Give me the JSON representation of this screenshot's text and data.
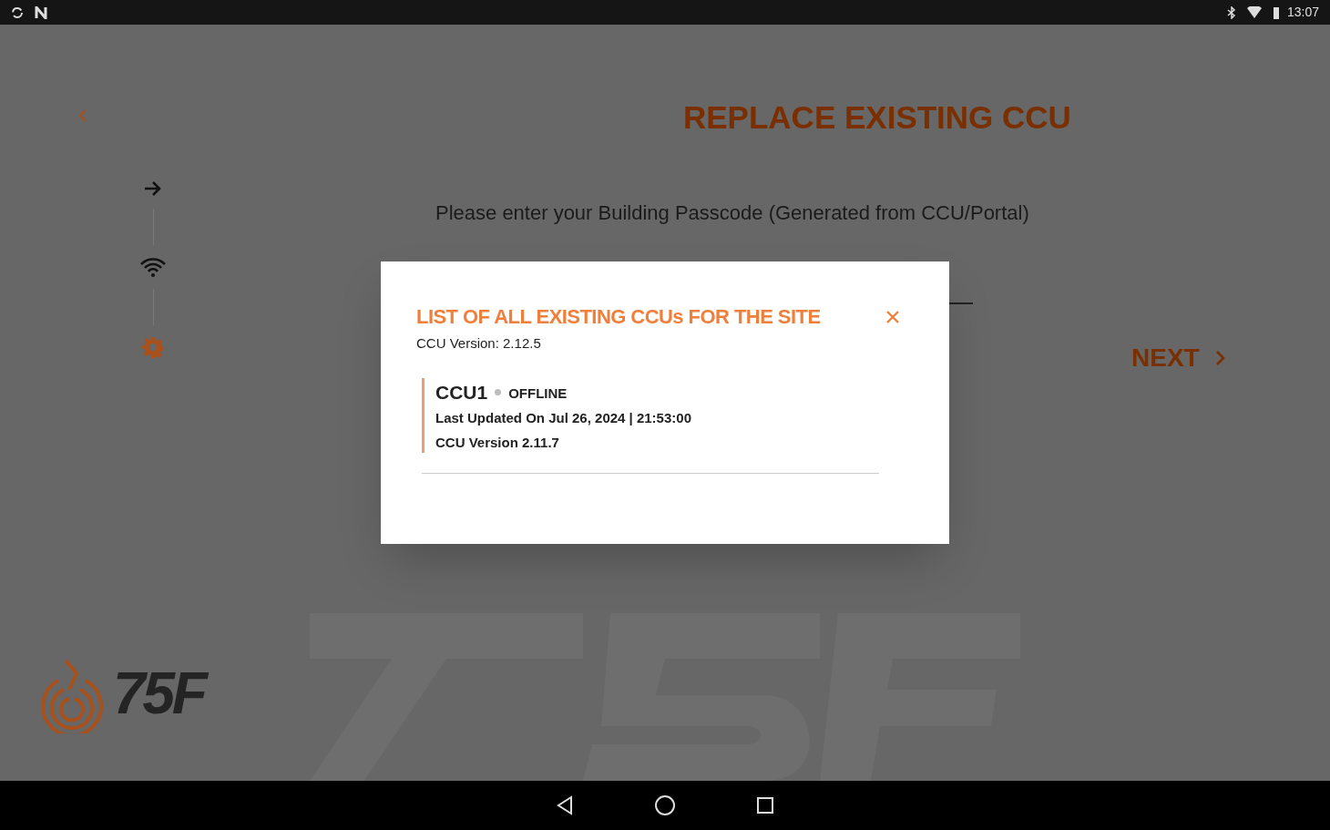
{
  "status_bar": {
    "time": "13:07"
  },
  "page": {
    "title": "REPLACE EXISTING CCU",
    "prompt": "Please enter your Building Passcode (Generated from CCU/Portal)",
    "next": "NEXT",
    "logo_text": "75F"
  },
  "steps": [
    {
      "kind": "arrow",
      "current": false
    },
    {
      "kind": "wifi",
      "current": false
    },
    {
      "kind": "gear",
      "current": true
    }
  ],
  "dialog": {
    "title": "LIST OF ALL EXISTING CCUs FOR THE SITE",
    "subtitle": "CCU Version: 2.12.5",
    "ccus": [
      {
        "name": "CCU1",
        "status": "OFFLINE",
        "online": false,
        "updated": "Last Updated On Jul 26, 2024 | 21:53:00",
        "version": "CCU Version 2.11.7"
      }
    ]
  }
}
